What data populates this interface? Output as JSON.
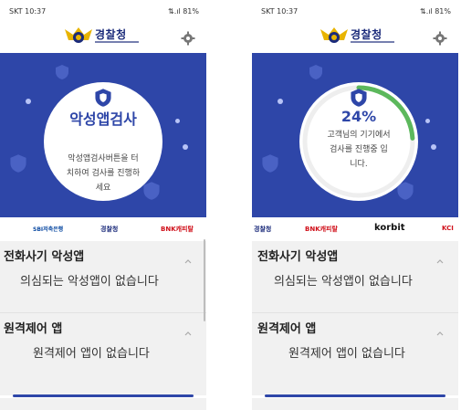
{
  "screens": [
    {
      "status_time": "SKT 10:37",
      "status_right": "⇅.ıl 81%",
      "brand": "경찰청",
      "scan_title": "악성앱검사",
      "scan_hint": "악성앱검사버튼을 터치하여 검사를 진행하세요",
      "partners": [
        "SBI저축은행",
        "경찰청",
        "BNK캐피탈"
      ],
      "sections": [
        {
          "title": "전화사기 악성앱",
          "message": "의심되는 악성앱이 없습니다"
        },
        {
          "title": "원격제어 앱",
          "message": "원격제어 앱이 없습니다"
        }
      ]
    },
    {
      "status_time": "SKT 10:37",
      "status_right": "⇅.ıl 81%",
      "brand": "경찰청",
      "scan_percent": "24%",
      "progress": 0.24,
      "scan_hint": "고객님의 기기에서 검사를 진행중 입니다.",
      "partners": [
        "경찰청",
        "BNK캐피탈",
        "korbit",
        "KCI"
      ],
      "sections": [
        {
          "title": "전화사기 악성앱",
          "message": "의심되는 악성앱이 없습니다"
        },
        {
          "title": "원격제어 앱",
          "message": "원격제어 앱이 없습니다"
        }
      ]
    }
  ],
  "colors": {
    "hero_bg": "#2e46a8",
    "progress": "#5cb85c",
    "brand_navy": "#1a2a7a",
    "emblem_gold": "#e8b400",
    "section_bg": "#f1f1f1"
  },
  "icons": [
    "police-emblem-icon",
    "gear-icon",
    "shield-icon",
    "chevron-up-icon"
  ]
}
